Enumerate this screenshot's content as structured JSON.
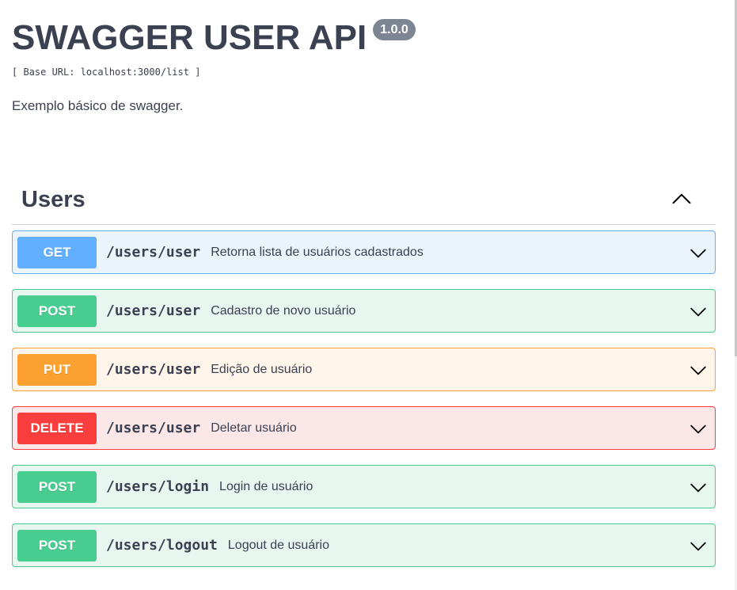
{
  "info": {
    "title": "SWAGGER USER API",
    "version": "1.0.0",
    "base_url": "[ Base URL: localhost:3000/list ]",
    "description": "Exemplo básico de swagger."
  },
  "section": {
    "title": "Users",
    "expanded": true,
    "toggle_icon": "chevron-up-icon"
  },
  "operations": [
    {
      "method": "GET",
      "path": "/users/user",
      "summary": "Retorna lista de usuários cadastrados",
      "color": "#61affe"
    },
    {
      "method": "POST",
      "path": "/users/user",
      "summary": "Cadastro de novo usuário",
      "color": "#49cc90"
    },
    {
      "method": "PUT",
      "path": "/users/user",
      "summary": "Edição de usuário",
      "color": "#fca130"
    },
    {
      "method": "DELETE",
      "path": "/users/user",
      "summary": "Deletar usuário",
      "color": "#f93e3e"
    },
    {
      "method": "POST",
      "path": "/users/login",
      "summary": "Login de usuário",
      "color": "#49cc90"
    },
    {
      "method": "POST",
      "path": "/users/logout",
      "summary": "Logout de usuário",
      "color": "#49cc90"
    }
  ],
  "colors": {
    "text": "#3b4151",
    "version_badge": "#7d8492"
  }
}
